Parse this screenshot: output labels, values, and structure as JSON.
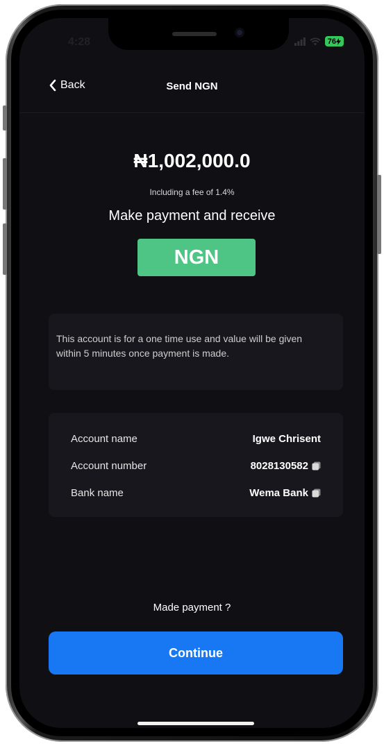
{
  "status_bar": {
    "time": "4:28",
    "battery_level": "76",
    "icons": [
      "signal-icon",
      "wifi-icon",
      "battery-charging-icon"
    ],
    "battery_color": "#34c759"
  },
  "nav": {
    "back_label": "Back",
    "back_icon": "chevron-left-icon",
    "title": "Send NGN"
  },
  "summary": {
    "amount": "₦1,002,000.0",
    "fee_note": "Including a fee of 1.4%",
    "instruction": "Make payment and receive",
    "currency": "NGN",
    "currency_color": "#4fc585"
  },
  "notice": {
    "text": "This account is for a one time use and value will be given within 5 minutes once payment is made."
  },
  "account_details": [
    {
      "label": "Account name",
      "value": "Igwe Chrisent",
      "copyable": false
    },
    {
      "label": "Account number",
      "value": "8028130582",
      "copyable": true,
      "icon": "copy-icon"
    },
    {
      "label": "Bank name",
      "value": "Wema Bank",
      "copyable": true,
      "icon": "copy-icon"
    }
  ],
  "footer": {
    "prompt": "Made payment ?",
    "continue_label": "Continue",
    "button_color": "#1877f2"
  },
  "colors": {
    "background": "#0f0f14",
    "card": "#17171d"
  }
}
